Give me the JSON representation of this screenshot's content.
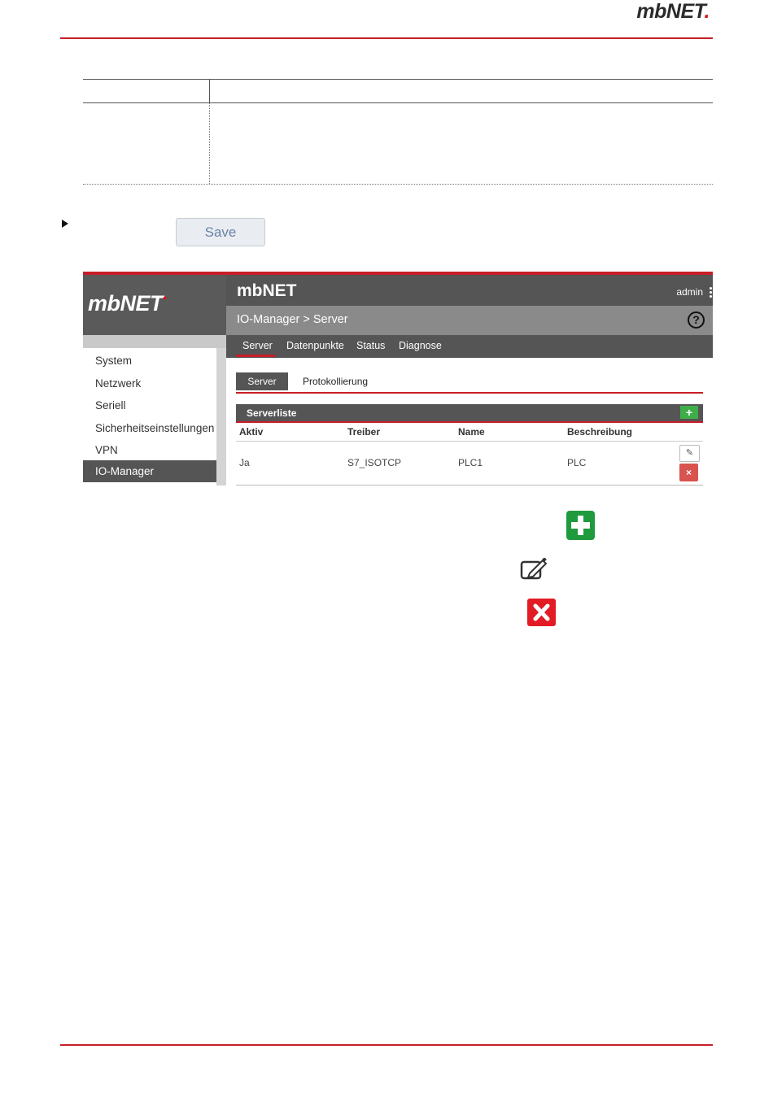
{
  "page": {
    "brand": "mbNET",
    "brand_dot": ".",
    "save_label": "Save"
  },
  "screenshot": {
    "logo": "mbNET",
    "logo_mark": "•",
    "app_title": "mbNET",
    "user": "admin",
    "breadcrumb": "IO-Manager > Server",
    "help_icon": "?",
    "sidebar": [
      {
        "label": "System",
        "active": false
      },
      {
        "label": "Netzwerk",
        "active": false
      },
      {
        "label": "Seriell",
        "active": false
      },
      {
        "label": "Sicherheitseinstellungen",
        "active": false
      },
      {
        "label": "VPN",
        "active": false
      },
      {
        "label": "IO-Manager",
        "active": true
      }
    ],
    "tabs": [
      "Server",
      "Datenpunkte",
      "Status",
      "Diagnose"
    ],
    "subtabs": [
      "Server",
      "Protokollierung"
    ],
    "list_title": "Serverliste",
    "add_symbol": "+",
    "columns": [
      "Aktiv",
      "Treiber",
      "Name",
      "Beschreibung"
    ],
    "rows": [
      {
        "aktiv": "Ja",
        "treiber": "S7_ISOTCP",
        "name": "PLC1",
        "beschreibung": "PLC"
      }
    ],
    "edit_symbol": "✎",
    "delete_symbol": "×"
  },
  "colors": {
    "accent_red": "#c81e27",
    "dark_gray": "#555555",
    "add_green": "#1f9a3d",
    "delete_red": "#e21b25"
  },
  "icons": [
    "add-icon",
    "edit-icon",
    "delete-icon",
    "help-icon",
    "kebab-menu-icon"
  ]
}
